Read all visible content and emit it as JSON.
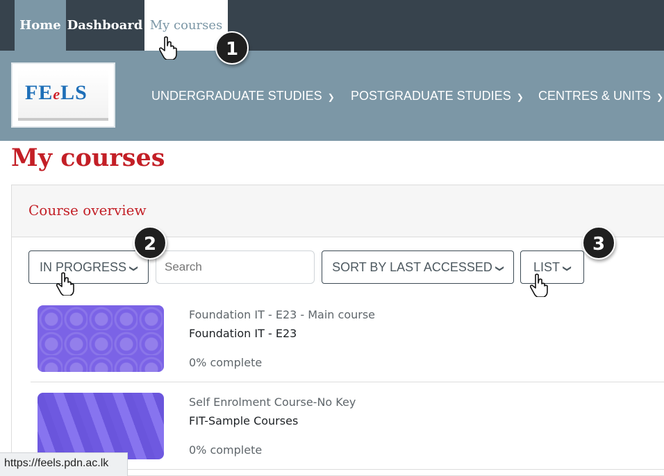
{
  "topnav": {
    "items": [
      {
        "label": "Home"
      },
      {
        "label": "Dashboard"
      },
      {
        "label": "My courses"
      }
    ]
  },
  "logo": {
    "text_left": "FE",
    "text_mid": "e",
    "text_right": "LS"
  },
  "mainnav": {
    "items": [
      {
        "label": "UNDERGRADUATE STUDIES"
      },
      {
        "label": "POSTGRADUATE STUDIES"
      },
      {
        "label": "CENTRES & UNITS"
      }
    ]
  },
  "page": {
    "title": "My courses"
  },
  "overview": {
    "title": "Course overview",
    "filter_label": "IN PROGRESS",
    "search_placeholder": "Search",
    "sort_label": "SORT BY LAST ACCESSED",
    "view_label": "LIST"
  },
  "courses": [
    {
      "category": "Foundation IT - E23 - Main course",
      "name": "Foundation IT - E23",
      "progress": "0% complete",
      "progress_percent": 0
    },
    {
      "category": "Self Enrolment Course-No Key",
      "name": "FIT-Sample Courses",
      "progress": "0% complete",
      "progress_percent": 0
    }
  ],
  "badges": [
    "1",
    "2",
    "3"
  ],
  "statusbar": {
    "url": "https://feels.pdn.ac.lk"
  },
  "colors": {
    "topbar": "#37434d",
    "header": "#7c97a6",
    "accent_red": "#c31f26",
    "thumbnail": "#7966e6"
  },
  "icons": [
    "chevron-down-icon",
    "pointer-hand-icon"
  ]
}
